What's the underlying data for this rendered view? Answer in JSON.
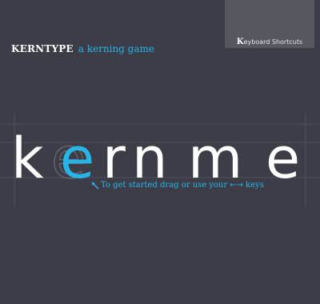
{
  "header": {
    "logo": "KERNTYPE",
    "tagline": "a kerning game"
  },
  "shortcuts": {
    "key": "K",
    "rest": "eyboard Shortcuts"
  },
  "game": {
    "letters": [
      "k",
      "e",
      "r",
      "n",
      "m",
      "e"
    ],
    "active_letter_index": 1
  },
  "hint": {
    "text": "To get started drag or use your",
    "arrows": "←→",
    "suffix": "keys"
  },
  "colors": {
    "background": "#3d3d48",
    "accent": "#27b5e8",
    "letter": "#ffffff",
    "button": "#57575f"
  }
}
